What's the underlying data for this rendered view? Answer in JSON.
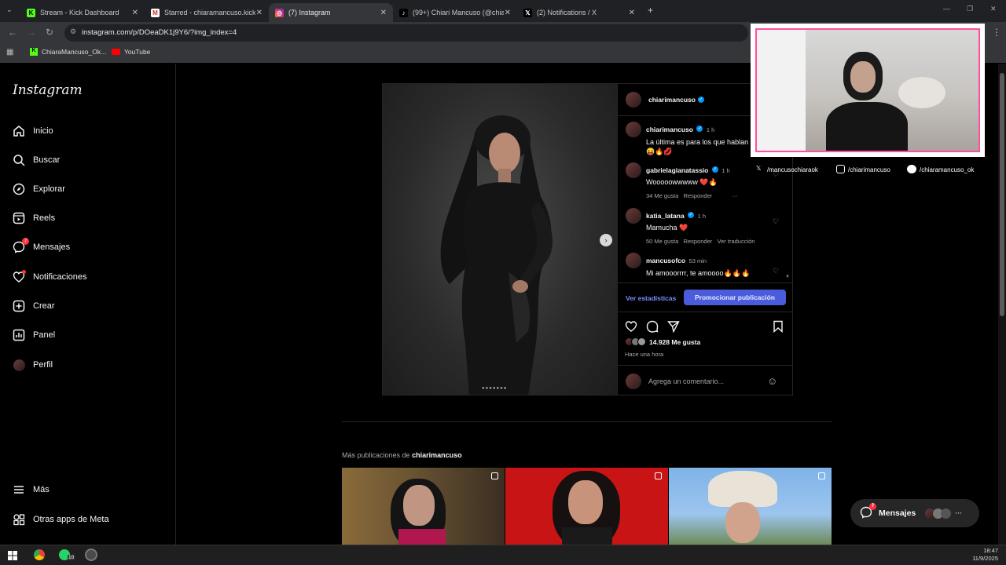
{
  "browser": {
    "tabs": [
      {
        "label": "Stream - Kick Dashboard",
        "active": false
      },
      {
        "label": "Starred - chiaramancuso.kick@",
        "active": false
      },
      {
        "label": "(7) Instagram",
        "active": true
      },
      {
        "label": "(99+) Chiari Mancuso (@chiaran",
        "active": false
      },
      {
        "label": "(2) Notifications / X",
        "active": false
      }
    ],
    "url": "instagram.com/p/DOeaDK1j9Y6/?img_index=4",
    "bookmarks": [
      "ChiaraMancuso_Ok...",
      "YouTube"
    ]
  },
  "sidebar": {
    "logo": "Instagram",
    "items": [
      {
        "label": "Inicio",
        "icon": "home-icon"
      },
      {
        "label": "Buscar",
        "icon": "search-icon"
      },
      {
        "label": "Explorar",
        "icon": "compass-icon"
      },
      {
        "label": "Reels",
        "icon": "reels-icon"
      },
      {
        "label": "Mensajes",
        "icon": "messenger-icon",
        "badge": "7"
      },
      {
        "label": "Notificaciones",
        "icon": "heart-icon"
      },
      {
        "label": "Crear",
        "icon": "plus-square-icon"
      },
      {
        "label": "Panel",
        "icon": "chart-icon"
      },
      {
        "label": "Perfil",
        "icon": "avatar"
      }
    ],
    "more": "Más",
    "meta": "Otras apps de Meta"
  },
  "post": {
    "author": "chiarimancuso",
    "caption": {
      "user": "chiarimancuso",
      "time": "1 h",
      "text": "La última es para los que hablan sin saber 😝🔥💋"
    },
    "comments": [
      {
        "user": "gabrielagianatassio",
        "time": "1 h",
        "text": "Wooooowwwww ❤️🔥",
        "likes": "34 Me gusta",
        "reply": "Responder",
        "translate": ""
      },
      {
        "user": "katia_latana",
        "time": "1 h",
        "text": "Mamucha ❤️",
        "likes": "50 Me gusta",
        "reply": "Responder",
        "translate": "Ver traducción"
      },
      {
        "user": "mancusofco",
        "time": "53 min",
        "text": "Mi amooorrrr, te amoooo🔥🔥🔥",
        "likes": "",
        "reply": "",
        "translate": ""
      }
    ],
    "stats_button": "Ver estadísticas",
    "promote_button": "Promocionar publicación",
    "likes": "14.928 Me gusta",
    "posted": "Hace una hora",
    "comment_placeholder": "Agrega un comentario..."
  },
  "more_posts": {
    "prefix": "Más publicaciones de",
    "user": "chiarimancuso"
  },
  "messages_pill": {
    "label": "Mensajes",
    "badge": "7"
  },
  "stream_overlay": {
    "socials": [
      "/mancusochiaraok",
      "/chiarimancuso",
      "/chiaramancuso_ok"
    ]
  },
  "taskbar": {
    "time": "18:47",
    "date": "11/9/2025",
    "whatsapp_badge": "10"
  },
  "colors": {
    "accent": "#0095f6",
    "promote": "#4a5bdc",
    "badge": "#ff3040"
  }
}
